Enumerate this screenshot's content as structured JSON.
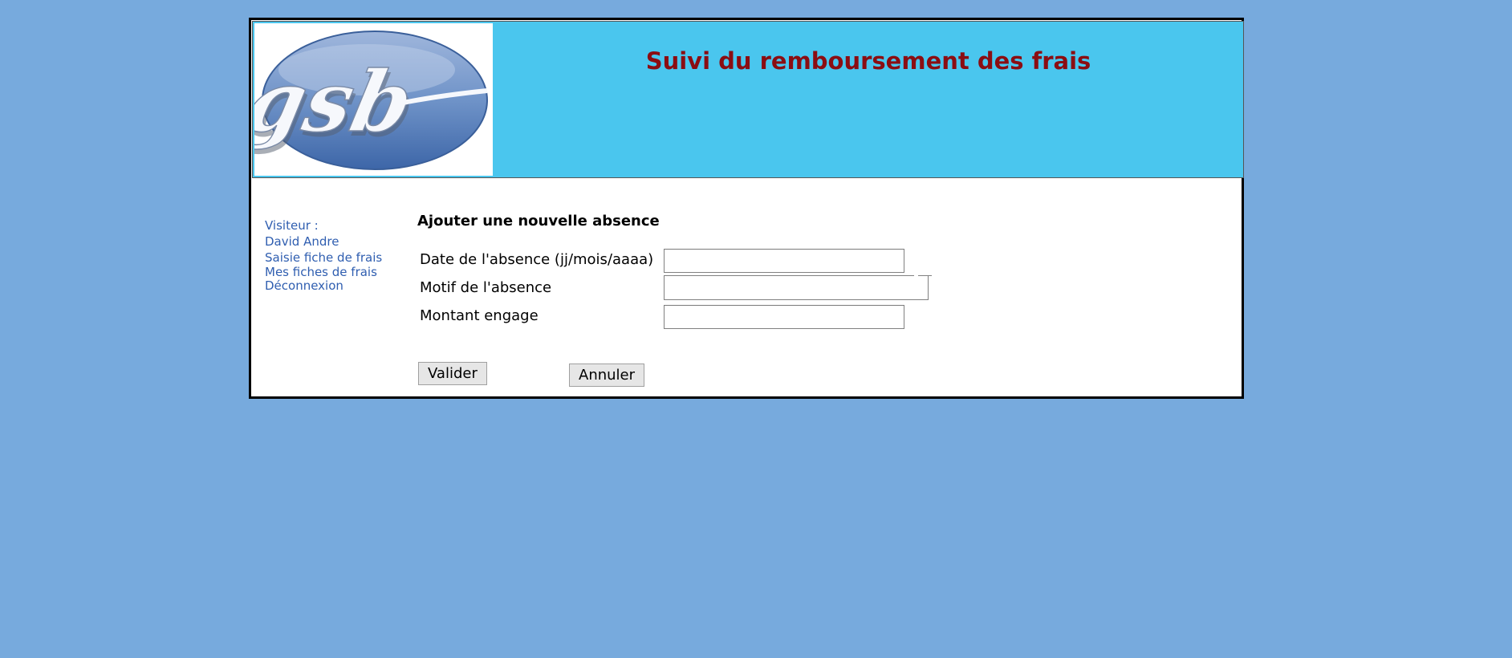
{
  "header": {
    "logo_text": "gsb",
    "title": "Suivi du remboursement des frais"
  },
  "menu": {
    "visitor_label": "Visiteur :",
    "visitor_name": "David Andre",
    "items": [
      {
        "label": "Saisie fiche de frais"
      },
      {
        "label": "Mes fiches de frais"
      },
      {
        "label": "Déconnexion"
      }
    ]
  },
  "form": {
    "title": "Ajouter une nouvelle absence",
    "fields": [
      {
        "label": "Date de l'absence (jj/mois/aaaa)",
        "value": ""
      },
      {
        "label": "Motif de l'absence",
        "value": ""
      },
      {
        "label": "Montant engage",
        "value": ""
      }
    ],
    "submit_label": "Valider",
    "cancel_label": "Annuler"
  },
  "colors": {
    "background": "#77aadd",
    "header_background": "#4ac6ee",
    "title": "#8b0d12",
    "menu_link": "#2f5eb0"
  }
}
